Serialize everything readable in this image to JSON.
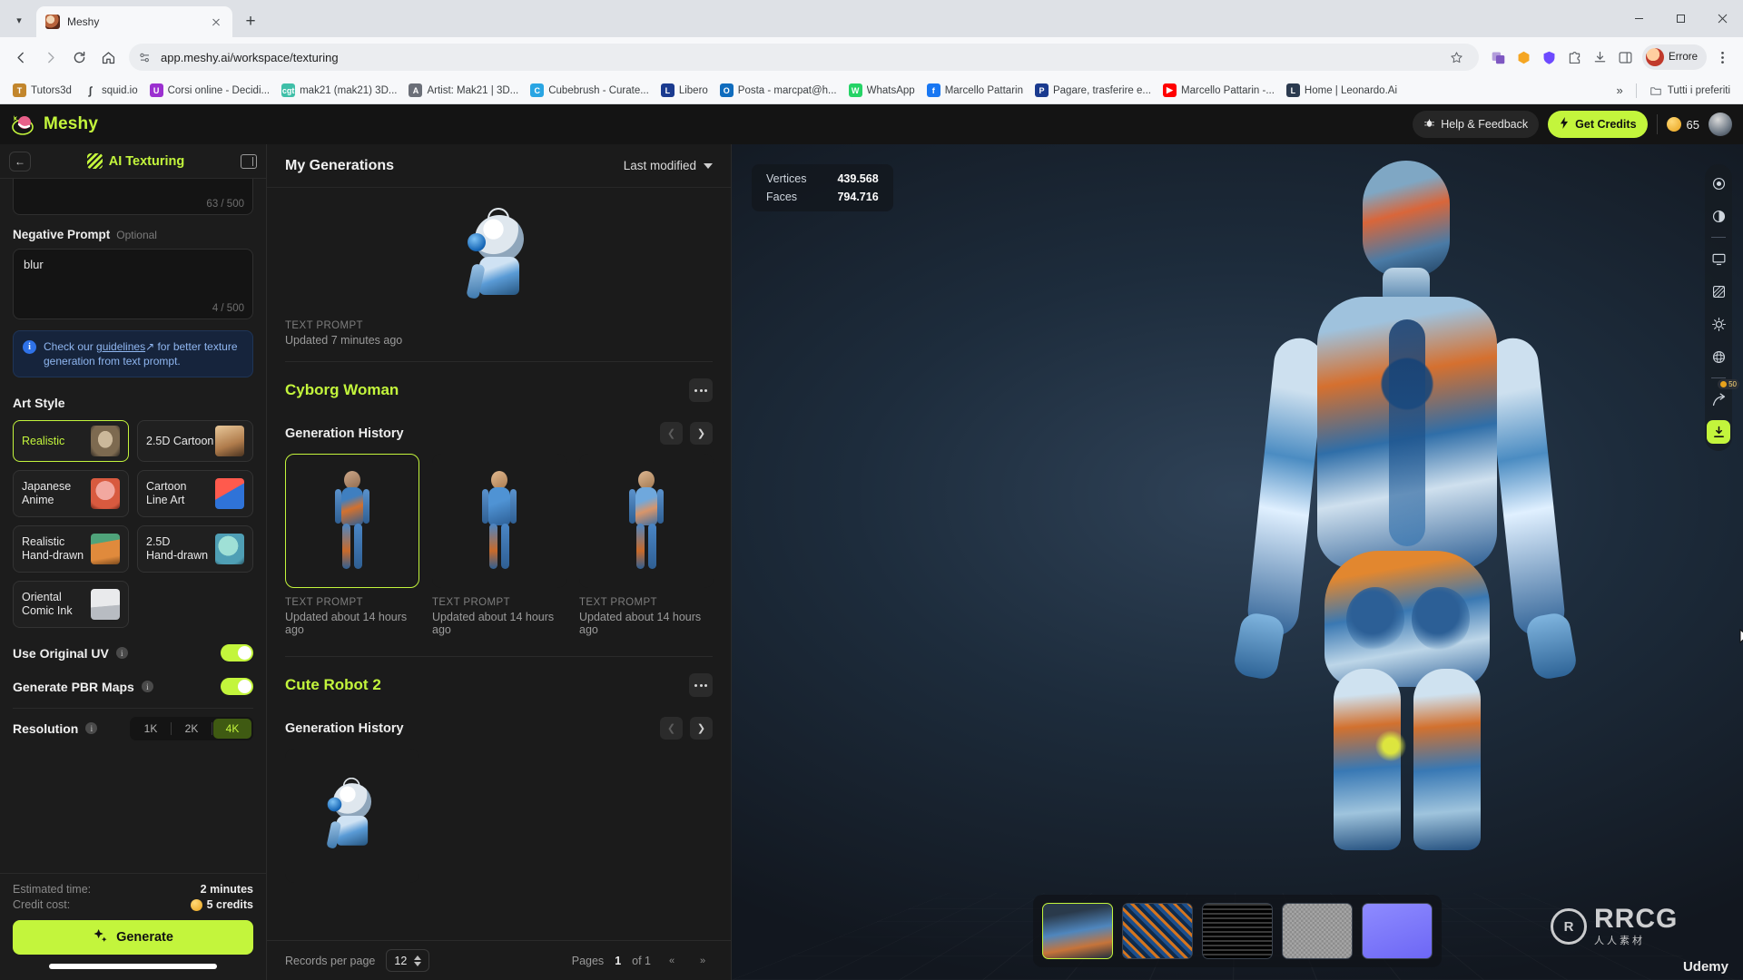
{
  "browser": {
    "tab": {
      "title": "Meshy"
    },
    "new_tab_label": "+",
    "url": "app.meshy.ai/workspace/texturing",
    "profile_name": "Errore",
    "bookmarks": [
      {
        "label": "Tutors3d",
        "color": "#c2862c",
        "glyph": "T"
      },
      {
        "label": "squid.io",
        "color": "#00000000",
        "glyph": "∫"
      },
      {
        "label": "Corsi online - Decidi...",
        "color": "#9b30d0",
        "glyph": "U"
      },
      {
        "label": "mak21 (mak21) 3D...",
        "color": "#3fbfa8",
        "glyph": "cgt"
      },
      {
        "label": "Artist: Mak21 | 3D...",
        "color": "#6b6f78",
        "glyph": "A"
      },
      {
        "label": "Cubebrush - Curate...",
        "color": "#29a5e3",
        "glyph": "C"
      },
      {
        "label": "Libero",
        "color": "#1a3a8f",
        "glyph": "L"
      },
      {
        "label": "Posta - marcpat@h...",
        "color": "#0f6cbd",
        "glyph": "O"
      },
      {
        "label": "WhatsApp",
        "color": "#25d366",
        "glyph": "W"
      },
      {
        "label": "Marcello Pattarin",
        "color": "#1877f2",
        "glyph": "f"
      },
      {
        "label": "Pagare, trasferire e...",
        "color": "#1a3a8f",
        "glyph": "P"
      },
      {
        "label": "Marcello Pattarin -...",
        "color": "#ff0000",
        "glyph": "▶"
      },
      {
        "label": "Home | Leonardo.Ai",
        "color": "#2b3a4f",
        "glyph": "L"
      }
    ],
    "bookmarks_overflow": "»",
    "all_bookmarks_label": "Tutti i preferiti"
  },
  "app": {
    "brand": "Meshy",
    "help_label": "Help & Feedback",
    "credits_label": "Get Credits",
    "credits_count": "65"
  },
  "left_panel": {
    "title": "AI Texturing",
    "prompt_counter": "63 / 500",
    "negative_prompt": {
      "label": "Negative Prompt",
      "optional": "Optional",
      "value": "blur",
      "counter": "4 / 500"
    },
    "notice": {
      "prefix": "Check our ",
      "link": "guidelines",
      "arrow": "↗",
      "suffix": " for better texture generation from text prompt."
    },
    "art_style": {
      "title": "Art Style",
      "options": [
        {
          "label": "Realistic",
          "selected": true,
          "thumb": "th-realistic"
        },
        {
          "label": "2.5D Cartoon",
          "selected": false,
          "thumb": "th-25cartoon"
        },
        {
          "label": "Japanese\nAnime",
          "selected": false,
          "thumb": "th-anime"
        },
        {
          "label": "Cartoon\nLine Art",
          "selected": false,
          "thumb": "th-lineart"
        },
        {
          "label": "Realistic\nHand-drawn",
          "selected": false,
          "thumb": "th-rhand"
        },
        {
          "label": "2.5D\nHand-drawn",
          "selected": false,
          "thumb": "th-25hand"
        },
        {
          "label": "Oriental\nComic Ink",
          "selected": false,
          "thumb": "th-oriental"
        }
      ]
    },
    "use_original_uv": {
      "label": "Use Original UV",
      "on": true
    },
    "generate_pbr": {
      "label": "Generate PBR Maps",
      "on": true
    },
    "resolution": {
      "label": "Resolution",
      "options": [
        "1K",
        "2K",
        "4K"
      ],
      "selected": "4K"
    },
    "estimated_time_label": "Estimated time:",
    "estimated_time_value": "2 minutes",
    "credit_cost_label": "Credit cost:",
    "credit_cost_value": "5 credits",
    "generate_button": "Generate"
  },
  "generations": {
    "title": "My Generations",
    "sort": "Last modified",
    "recent": {
      "kind": "TEXT PROMPT",
      "updated": "Updated 7 minutes ago"
    },
    "projects": [
      {
        "name": "Cyborg Woman",
        "history_title": "Generation History",
        "items": [
          {
            "kind": "TEXT PROMPT",
            "updated": "Updated about 14 hours ago",
            "selected": true,
            "variant": "a"
          },
          {
            "kind": "TEXT PROMPT",
            "updated": "Updated about 14 hours ago",
            "selected": false,
            "variant": "b"
          },
          {
            "kind": "TEXT PROMPT",
            "updated": "Updated about 14 hours ago",
            "selected": false,
            "variant": "c"
          }
        ]
      },
      {
        "name": "Cute Robot 2",
        "history_title": "Generation History",
        "items": []
      }
    ],
    "footer": {
      "records_label": "Records per page",
      "records_value": "12",
      "pages_label": "Pages",
      "page_current": "1",
      "page_of": "of 1",
      "first_btn": "«",
      "last_btn": "»"
    }
  },
  "viewport": {
    "stats": {
      "vertices_label": "Vertices",
      "vertices_value": "439.568",
      "faces_label": "Faces",
      "faces_value": "794.716"
    },
    "download_badge": "50",
    "textures": [
      {
        "name": "model-preview",
        "selected": true
      },
      {
        "name": "albedo-map",
        "selected": false
      },
      {
        "name": "normal-map",
        "selected": false
      },
      {
        "name": "roughness-map",
        "selected": false
      },
      {
        "name": "metallic-map",
        "selected": false
      }
    ],
    "watermark_main": "RRCG",
    "watermark_sub": "人人素材",
    "watermark_badge": "R",
    "udemy": "Udemy"
  }
}
